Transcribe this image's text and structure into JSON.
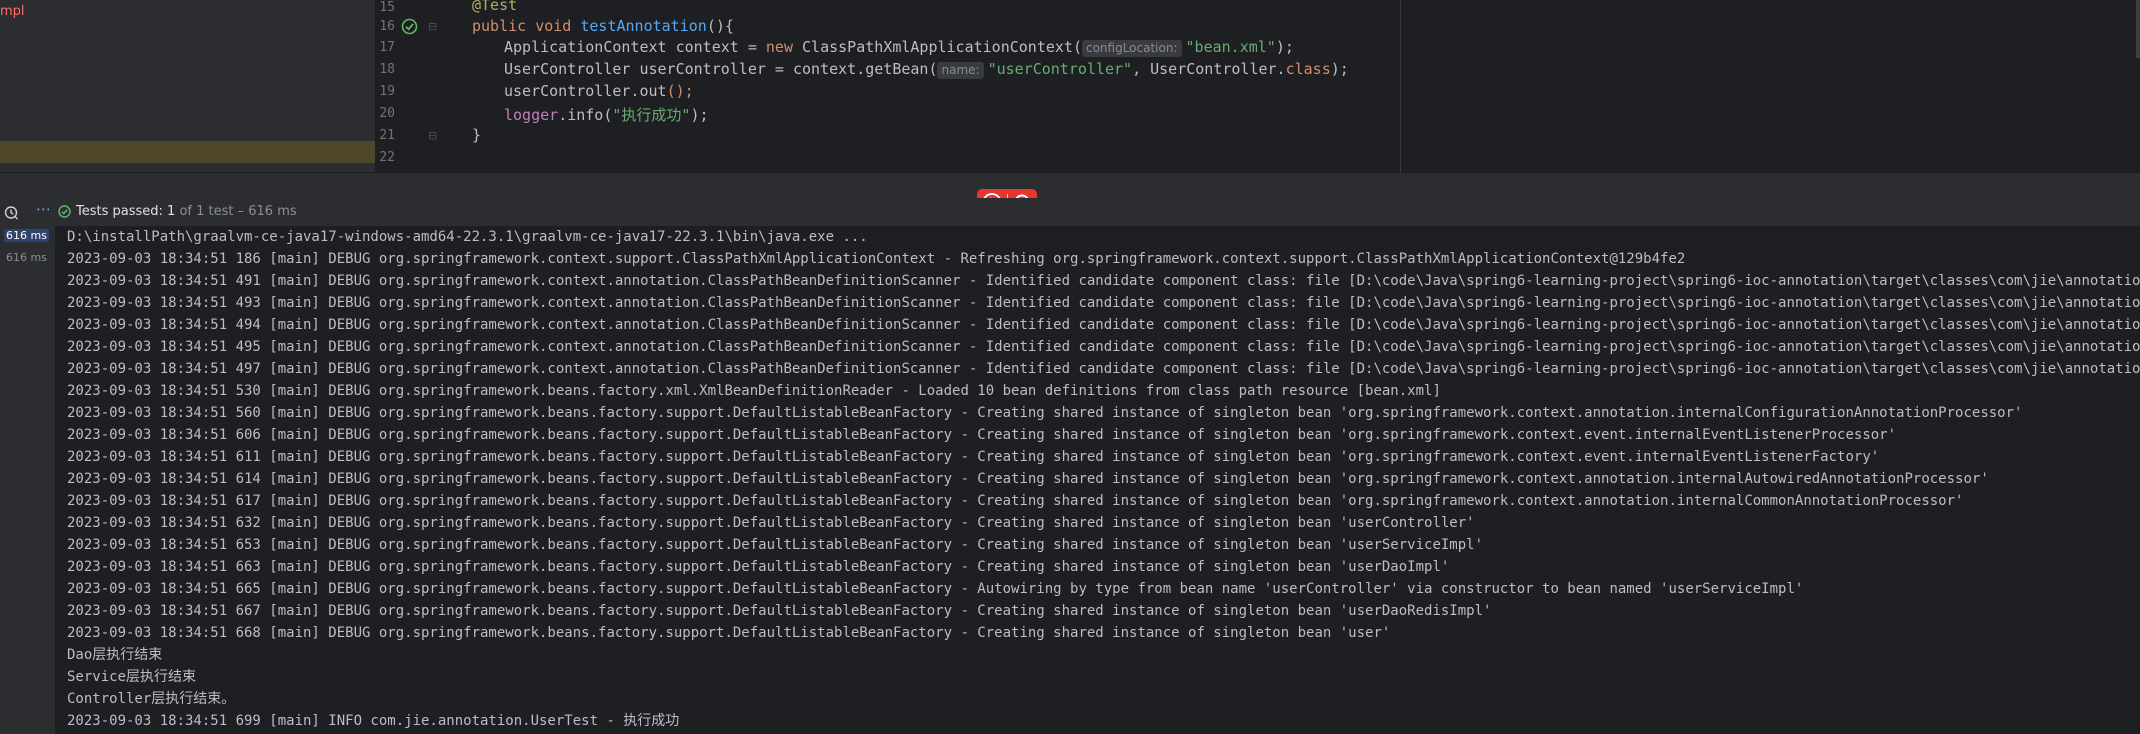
{
  "project_panel": {
    "text": "mpl"
  },
  "editor": {
    "line_numbers": [
      "15",
      "16",
      "17",
      "18",
      "19",
      "20",
      "21",
      "22"
    ],
    "lines": {
      "l15": {
        "annotation": "@Test"
      },
      "l16": {
        "kw1": "public",
        "kw2": "void",
        "method": "testAnnotation",
        "rest": "(){"
      },
      "l17": {
        "type": "ApplicationContext context = ",
        "new": "new",
        "cls": " ClassPathXmlApplicationContext(",
        "hint": "configLocation:",
        "str": "\"bean.xml\"",
        "end": ");"
      },
      "l18": {
        "pre": "UserController userController = context.getBean(",
        "hint": "name:",
        "str": "\"userController\"",
        "mid": ", UserController.",
        "kw": "class",
        "end": ");"
      },
      "l19": {
        "pre": "userController.out",
        "end": "();"
      },
      "l20": {
        "logger": "logger",
        "mid": ".info(",
        "str": "\"执行成功\"",
        "end": ");"
      },
      "l21": {
        "brace": "}"
      }
    }
  },
  "run_toolbar": {
    "status_main": "Tests passed: ",
    "status_count": "1",
    "status_detail": " of 1 test – 616 ms"
  },
  "test_tree": {
    "durations": [
      "616 ms",
      "616 ms"
    ]
  },
  "console": {
    "command": "D:\\installPath\\graalvm-ce-java17-windows-amd64-22.3.1\\graalvm-ce-java17-22.3.1\\bin\\java.exe ...",
    "lines": [
      "2023-09-03 18:34:51 186 [main] DEBUG org.springframework.context.support.ClassPathXmlApplicationContext - Refreshing org.springframework.context.support.ClassPathXmlApplicationContext@129b4fe2",
      "2023-09-03 18:34:51 491 [main] DEBUG org.springframework.context.annotation.ClassPathBeanDefinitionScanner - Identified candidate component class: file [D:\\code\\Java\\spring6-learning-project\\spring6-ioc-annotation\\target\\classes\\com\\jie\\annotation\\controller\\Us",
      "2023-09-03 18:34:51 493 [main] DEBUG org.springframework.context.annotation.ClassPathBeanDefinitionScanner - Identified candidate component class: file [D:\\code\\Java\\spring6-learning-project\\spring6-ioc-annotation\\target\\classes\\com\\jie\\annotation\\dao\\impl\\Us",
      "2023-09-03 18:34:51 494 [main] DEBUG org.springframework.context.annotation.ClassPathBeanDefinitionScanner - Identified candidate component class: file [D:\\code\\Java\\spring6-learning-project\\spring6-ioc-annotation\\target\\classes\\com\\jie\\annotation\\dao\\impl\\Us",
      "2023-09-03 18:34:51 495 [main] DEBUG org.springframework.context.annotation.ClassPathBeanDefinitionScanner - Identified candidate component class: file [D:\\code\\Java\\spring6-learning-project\\spring6-ioc-annotation\\target\\classes\\com\\jie\\annotation\\model\\User.",
      "2023-09-03 18:34:51 497 [main] DEBUG org.springframework.context.annotation.ClassPathBeanDefinitionScanner - Identified candidate component class: file [D:\\code\\Java\\spring6-learning-project\\spring6-ioc-annotation\\target\\classes\\com\\jie\\annotation\\service\\imp",
      "2023-09-03 18:34:51 530 [main] DEBUG org.springframework.beans.factory.xml.XmlBeanDefinitionReader - Loaded 10 bean definitions from class path resource [bean.xml]",
      "2023-09-03 18:34:51 560 [main] DEBUG org.springframework.beans.factory.support.DefaultListableBeanFactory - Creating shared instance of singleton bean 'org.springframework.context.annotation.internalConfigurationAnnotationProcessor'",
      "2023-09-03 18:34:51 606 [main] DEBUG org.springframework.beans.factory.support.DefaultListableBeanFactory - Creating shared instance of singleton bean 'org.springframework.context.event.internalEventListenerProcessor'",
      "2023-09-03 18:34:51 611 [main] DEBUG org.springframework.beans.factory.support.DefaultListableBeanFactory - Creating shared instance of singleton bean 'org.springframework.context.event.internalEventListenerFactory'",
      "2023-09-03 18:34:51 614 [main] DEBUG org.springframework.beans.factory.support.DefaultListableBeanFactory - Creating shared instance of singleton bean 'org.springframework.context.annotation.internalAutowiredAnnotationProcessor'",
      "2023-09-03 18:34:51 617 [main] DEBUG org.springframework.beans.factory.support.DefaultListableBeanFactory - Creating shared instance of singleton bean 'org.springframework.context.annotation.internalCommonAnnotationProcessor'",
      "2023-09-03 18:34:51 632 [main] DEBUG org.springframework.beans.factory.support.DefaultListableBeanFactory - Creating shared instance of singleton bean 'userController'",
      "2023-09-03 18:34:51 653 [main] DEBUG org.springframework.beans.factory.support.DefaultListableBeanFactory - Creating shared instance of singleton bean 'userServiceImpl'",
      "2023-09-03 18:34:51 663 [main] DEBUG org.springframework.beans.factory.support.DefaultListableBeanFactory - Creating shared instance of singleton bean 'userDaoImpl'",
      "2023-09-03 18:34:51 665 [main] DEBUG org.springframework.beans.factory.support.DefaultListableBeanFactory - Autowiring by type from bean name 'userController' via constructor to bean named 'userServiceImpl'",
      "2023-09-03 18:34:51 667 [main] DEBUG org.springframework.beans.factory.support.DefaultListableBeanFactory - Creating shared instance of singleton bean 'userDaoRedisImpl'",
      "2023-09-03 18:34:51 668 [main] DEBUG org.springframework.beans.factory.support.DefaultListableBeanFactory - Creating shared instance of singleton bean 'user'",
      "Dao层执行结束",
      "Service层执行结束",
      "Controller层执行结束。",
      "2023-09-03 18:34:51 699 [main] INFO com.jie.annotation.UserTest - 执行成功"
    ]
  },
  "colors": {
    "editor_bg": "#1e1f22",
    "panel_bg": "#2b2d30",
    "keyword": "#cf8e6d",
    "string": "#6aab73",
    "method": "#56a8f5",
    "annotation": "#b3ae60",
    "test_passed": "#5fb865",
    "ai_widget": "#e8362f"
  }
}
